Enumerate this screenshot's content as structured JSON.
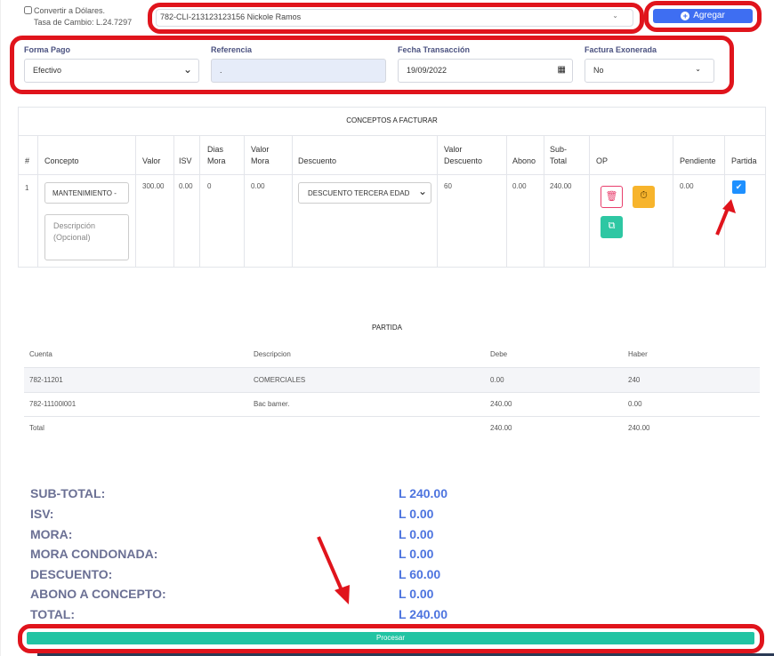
{
  "top": {
    "convert_label": "Convertir a Dólares.",
    "rate_label": "Tasa de Cambio: L.24.7297",
    "client_value": "782-CLI-213123123156 Nickole Ramos",
    "add_button": "Agregar"
  },
  "form": {
    "forma_pago_label": "Forma Pago",
    "forma_pago_value": "Efectivo",
    "referencia_label": "Referencia",
    "referencia_value": ".",
    "fecha_label": "Fecha Transacción",
    "fecha_value": "19/09/2022",
    "exonerada_label": "Factura Exonerada",
    "exonerada_value": "No"
  },
  "conceptos": {
    "title": "CONCEPTOS A FACTURAR",
    "headers": {
      "num": "#",
      "concepto": "Concepto",
      "valor": "Valor",
      "isv": "ISV",
      "dias_mora": "Dias\nMora",
      "valor_mora": "Valor\nMora",
      "descuento": "Descuento",
      "valor_descuento": "Valor\nDescuento",
      "abono": "Abono",
      "subtotal": "Sub-\nTotal",
      "op": "OP",
      "pendiente": "Pendiente",
      "partida": "Partida"
    },
    "row": {
      "num": "1",
      "concepto": "MANTENIMIENTO -",
      "descripcion_placeholder": "Descripción\n(Opcional)",
      "valor": "300.00",
      "isv": "0.00",
      "dias_mora": "0",
      "valor_mora": "0.00",
      "descuento": "DESCUENTO TERCERA EDAD",
      "valor_descuento": "60",
      "abono": "0.00",
      "subtotal": "240.00",
      "pendiente": "0.00"
    }
  },
  "partida": {
    "title": "PARTIDA",
    "headers": {
      "cuenta": "Cuenta",
      "descripcion": "Descripcion",
      "debe": "Debe",
      "haber": "Haber"
    },
    "rows": [
      {
        "cuenta": "782-11201",
        "descripcion": "COMERCIALES",
        "debe": "0.00",
        "haber": "240"
      },
      {
        "cuenta": "782-11100l001",
        "descripcion": "Bac bamer.",
        "debe": "240.00",
        "haber": "0.00"
      },
      {
        "cuenta": "Total",
        "descripcion": "",
        "debe": "240.00",
        "haber": "240.00"
      }
    ]
  },
  "totals": [
    {
      "label": "SUB-TOTAL:",
      "value": "L 240.00"
    },
    {
      "label": "ISV:",
      "value": "L 0.00"
    },
    {
      "label": "MORA:",
      "value": "L 0.00"
    },
    {
      "label": "MORA CONDONADA:",
      "value": "L 0.00"
    },
    {
      "label": "DESCUENTO:",
      "value": "L 60.00"
    },
    {
      "label": "ABONO A CONCEPTO:",
      "value": "L 0.00"
    },
    {
      "label": "TOTAL:",
      "value": "L 240.00"
    }
  ],
  "process_button": "Procesar",
  "colors": {
    "highlight": "#e0141c",
    "primary": "#3e6ef2",
    "teal": "#22c4a3"
  },
  "icons": {
    "delete": "trash-icon",
    "time": "timer-icon",
    "copy": "copy-icon",
    "check": "check-icon"
  }
}
